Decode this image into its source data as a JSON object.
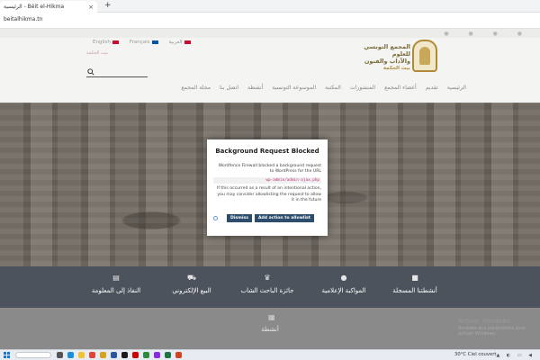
{
  "browser": {
    "tab_title": "الرئيسية - Béit el-Hikma",
    "tab_close": "×",
    "new_tab": "+",
    "url": "beitalhikma.tn"
  },
  "header": {
    "languages": [
      {
        "label": "English",
        "flag_color": "#c8102e"
      },
      {
        "label": "Français",
        "flag_color": "#0055a4"
      },
      {
        "label": "العربية",
        "flag_color": "#c8102e"
      }
    ],
    "small_link": "بيت الحكمة",
    "logo_line1": "المجمع التونسي للعلوم",
    "logo_line2": "والآداب والفنون",
    "logo_line3": "بيت الحكمة",
    "nav": [
      "الرئيسية",
      "تقديم",
      "أعضاء المجمع",
      "المنشورات",
      "المكتبة",
      "الموسوعة التونسية",
      "أنشطة",
      "اتصل بنا",
      "مجلة المجمع"
    ]
  },
  "services": [
    {
      "label": "أنشطتنا المسجلة",
      "icon": "camera-icon",
      "glyph": "■"
    },
    {
      "label": "المواكبة الإعلامية",
      "icon": "microphone-icon",
      "glyph": "●"
    },
    {
      "label": "جائزة الباحث الشاب",
      "icon": "trophy-icon",
      "glyph": "♛"
    },
    {
      "label": "البيع الإلكتروني",
      "icon": "cart-icon",
      "glyph": "⛟"
    },
    {
      "label": "النفاذ إلى المعلومة",
      "icon": "document-icon",
      "glyph": "▤"
    }
  ],
  "activities": {
    "title": "أنشطة",
    "icon": "calendar-icon",
    "glyph": "▦"
  },
  "modal": {
    "title": "Background Request Blocked",
    "text1": "Wordfence Firewall blocked a background request to WordPress for the URL",
    "blocked_url": "wp-admin/admin-ajax.php",
    "text2": "If this occurred as a result of an intentional action, you may consider allowlisting the request to allow it in the future",
    "dismiss": "Dismiss",
    "allow": "Add action to allowlist"
  },
  "windows": {
    "activate_title": "Activer Windows",
    "activate_sub": "Accédez aux paramètres pour activer Windows.",
    "weather": "30°C  Ciel couvert"
  }
}
